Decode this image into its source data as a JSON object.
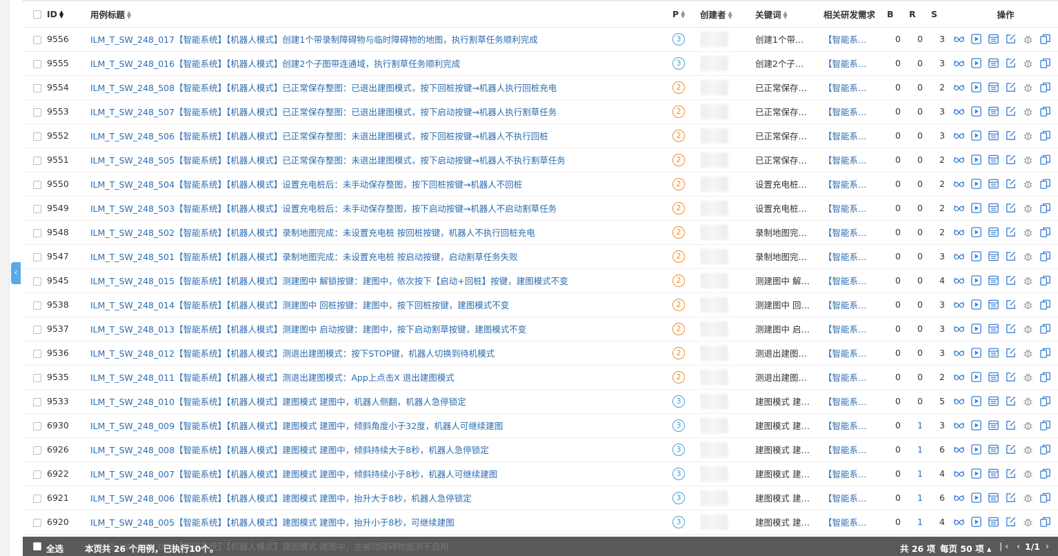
{
  "nav": {
    "collapse_icon": "‹"
  },
  "table": {
    "headers": {
      "id": "ID",
      "title": "用例标题",
      "priority": "P",
      "creator": "创建者",
      "keyword": "关键词",
      "requirement": "相关研发需求",
      "b": "B",
      "r": "R",
      "s": "S",
      "actions": "操作"
    },
    "action_icons": [
      "glasses-icon",
      "play-icon",
      "list-icon",
      "edit-icon",
      "bug-icon",
      "copy-icon"
    ],
    "rows": [
      {
        "id": "9556",
        "title": "ILM_T_SW_248_017【智能系统】【机器人模式】创建1个带录制障碍物与临时障碍物的地图，执行割草任务顺利完成",
        "p": "3",
        "keyword": "创建1个带…",
        "req": "【智能系…",
        "b": "0",
        "r": "0",
        "s": "3"
      },
      {
        "id": "9555",
        "title": "ILM_T_SW_248_016【智能系统】【机器人模式】创建2个子图带连通域，执行割草任务顺利完成",
        "p": "3",
        "keyword": "创建2个子…",
        "req": "【智能系…",
        "b": "0",
        "r": "0",
        "s": "3"
      },
      {
        "id": "9554",
        "title": "ILM_T_SW_248_508【智能系统】【机器人模式】已正常保存整图：已退出建图模式，按下回桩按键→机器人执行回桩充电",
        "p": "2",
        "keyword": "已正常保存…",
        "req": "【智能系…",
        "b": "0",
        "r": "0",
        "s": "2"
      },
      {
        "id": "9553",
        "title": "ILM_T_SW_248_507【智能系统】【机器人模式】已正常保存整图：已退出建图模式，按下启动按键→机器人执行割草任务",
        "p": "2",
        "keyword": "已正常保存…",
        "req": "【智能系…",
        "b": "0",
        "r": "0",
        "s": "3"
      },
      {
        "id": "9552",
        "title": "ILM_T_SW_248_506【智能系统】【机器人模式】已正常保存整图：未退出建图模式，按下回桩按键→机器人不执行回桩",
        "p": "2",
        "keyword": "已正常保存…",
        "req": "【智能系…",
        "b": "0",
        "r": "0",
        "s": "3"
      },
      {
        "id": "9551",
        "title": "ILM_T_SW_248_505【智能系统】【机器人模式】已正常保存整图：未退出建图模式，按下启动按键→机器人不执行割草任务",
        "p": "2",
        "keyword": "已正常保存…",
        "req": "【智能系…",
        "b": "0",
        "r": "0",
        "s": "2"
      },
      {
        "id": "9550",
        "title": "ILM_T_SW_248_504【智能系统】【机器人模式】设置充电桩后：未手动保存整图，按下回桩按键→机器人不回桩",
        "p": "2",
        "keyword": "设置充电桩…",
        "req": "【智能系…",
        "b": "0",
        "r": "0",
        "s": "2"
      },
      {
        "id": "9549",
        "title": "ILM_T_SW_248_503【智能系统】【机器人模式】设置充电桩后：未手动保存整图，按下启动按键→机器人不启动割草任务",
        "p": "2",
        "keyword": "设置充电桩…",
        "req": "【智能系…",
        "b": "0",
        "r": "0",
        "s": "2"
      },
      {
        "id": "9548",
        "title": "ILM_T_SW_248_502【智能系统】【机器人模式】录制地图完成：未设置充电桩 按回桩按键，机器人不执行回桩充电",
        "p": "2",
        "keyword": "录制地图完…",
        "req": "【智能系…",
        "b": "0",
        "r": "0",
        "s": "2"
      },
      {
        "id": "9547",
        "title": "ILM_T_SW_248_501【智能系统】【机器人模式】录制地图完成：未设置充电桩 按启动按键，启动割草任务失败",
        "p": "2",
        "keyword": "录制地图完…",
        "req": "【智能系…",
        "b": "0",
        "r": "0",
        "s": "3"
      },
      {
        "id": "9545",
        "title": "ILM_T_SW_248_015【智能系统】【机器人模式】测建图中 解锁按键：建图中，依次按下【启动+回桩】按键，建图模式不变",
        "p": "2",
        "keyword": "测建图中 解…",
        "req": "【智能系…",
        "b": "0",
        "r": "0",
        "s": "4"
      },
      {
        "id": "9538",
        "title": "ILM_T_SW_248_014【智能系统】【机器人模式】测建图中 回桩按键：建图中，按下回桩按键，建图模式不变",
        "p": "2",
        "keyword": "测建图中 回…",
        "req": "【智能系…",
        "b": "0",
        "r": "0",
        "s": "3"
      },
      {
        "id": "9537",
        "title": "ILM_T_SW_248_013【智能系统】【机器人模式】测建图中 启动按键：建图中，按下启动割草按键，建图模式不变",
        "p": "2",
        "keyword": "测建图中 启…",
        "req": "【智能系…",
        "b": "0",
        "r": "0",
        "s": "3"
      },
      {
        "id": "9536",
        "title": "ILM_T_SW_248_012【智能系统】【机器人模式】测退出建图模式：按下STOP键，机器人切换到待机模式",
        "p": "2",
        "keyword": "测退出建图…",
        "req": "【智能系…",
        "b": "0",
        "r": "0",
        "s": "3"
      },
      {
        "id": "9535",
        "title": "ILM_T_SW_248_011【智能系统】【机器人模式】测退出建图模式：App上点击X 退出建图模式",
        "p": "2",
        "keyword": "测退出建图…",
        "req": "【智能系…",
        "b": "0",
        "r": "0",
        "s": "2"
      },
      {
        "id": "9533",
        "title": "ILM_T_SW_248_010【智能系统】【机器人模式】建图模式 建图中，机器人侧翻，机器人急停锁定",
        "p": "3",
        "keyword": "建图模式 建…",
        "req": "【智能系…",
        "b": "0",
        "r": "0",
        "s": "5"
      },
      {
        "id": "6930",
        "title": "ILM_T_SW_248_009【智能系统】【机器人模式】建图模式 建图中，倾斜角度小于32度，机器人可继续建图",
        "p": "3",
        "keyword": "建图模式 建…",
        "req": "【智能系…",
        "b": "0",
        "r": "1",
        "s": "3"
      },
      {
        "id": "6926",
        "title": "ILM_T_SW_248_008【智能系统】【机器人模式】建图模式 建图中，倾斜持续大于8秒，机器人急停锁定",
        "p": "3",
        "keyword": "建图模式 建…",
        "req": "【智能系…",
        "b": "0",
        "r": "1",
        "s": "6"
      },
      {
        "id": "6922",
        "title": "ILM_T_SW_248_007【智能系统】【机器人模式】建图模式 建图中，倾斜持续小于8秒，机器人可继续建图",
        "p": "3",
        "keyword": "建图模式 建…",
        "req": "【智能系…",
        "b": "0",
        "r": "1",
        "s": "4"
      },
      {
        "id": "6921",
        "title": "ILM_T_SW_248_006【智能系统】【机器人模式】建图模式 建图中，抬升大于8秒，机器人急停锁定",
        "p": "3",
        "keyword": "建图模式 建…",
        "req": "【智能系…",
        "b": "0",
        "r": "1",
        "s": "6"
      },
      {
        "id": "6920",
        "title": "ILM_T_SW_248_005【智能系统】【机器人模式】建图模式 建图中，抬升小于8秒，可继续建图",
        "p": "3",
        "keyword": "建图模式 建…",
        "req": "【智能系…",
        "b": "0",
        "r": "1",
        "s": "4"
      }
    ]
  },
  "footer": {
    "select_all_label": "全选",
    "summary": "本页共 26 个用例，已执行10个。",
    "peek_row_text": "ILM_T_SW_248_004【智能系统】【机器人模式】建图模式 建图中，主被动障碍物监测不启用",
    "total_label": "共 26 项",
    "per_page_label": "每页 50 项 ▴",
    "page_label": "1/1"
  },
  "colors": {
    "p2": "#f08a24",
    "p3": "#3ea3d8",
    "link": "#2b6cb0",
    "footer_bg": "#595959"
  }
}
